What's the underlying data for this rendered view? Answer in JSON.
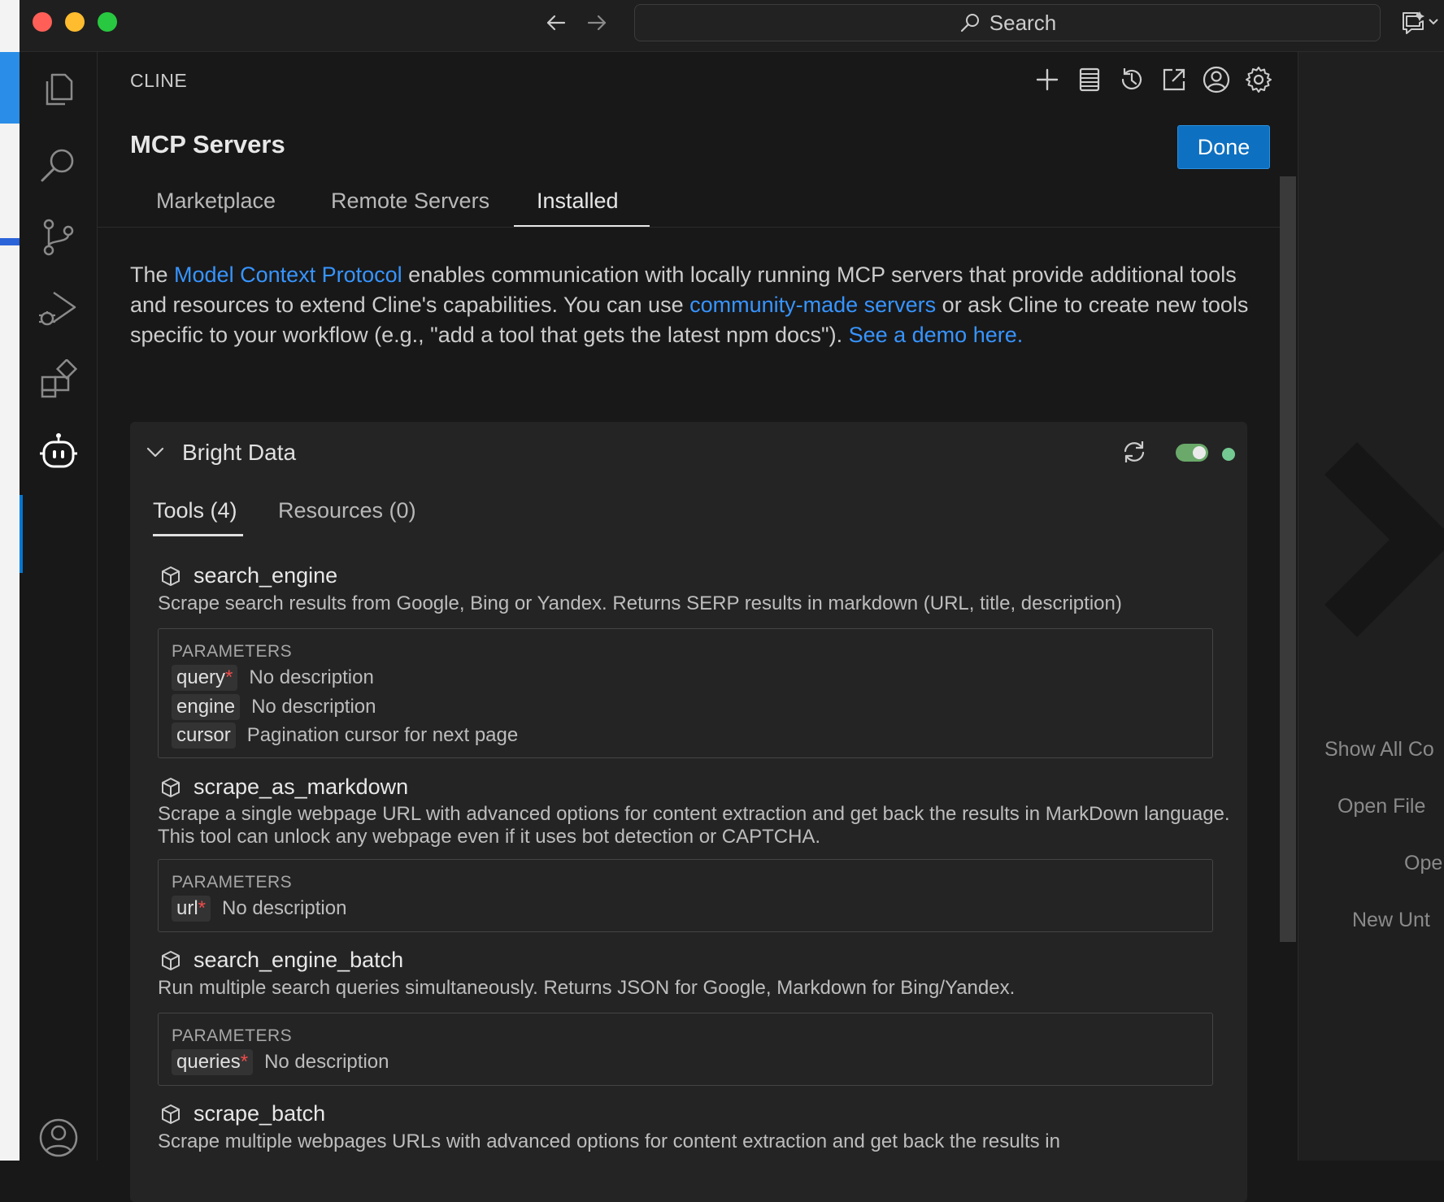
{
  "titlebar": {
    "search_label": "Search"
  },
  "panel": {
    "title": "CLINE",
    "heading": "MCP Servers",
    "done_label": "Done",
    "tabs": [
      {
        "label": "Marketplace"
      },
      {
        "label": "Remote Servers"
      },
      {
        "label": "Installed"
      }
    ],
    "intro": {
      "p1": "The ",
      "link1": "Model Context Protocol",
      "p2": " enables communication with locally running MCP servers that provide additional tools and resources to extend Cline's capabilities. You can use ",
      "link2": "community-made servers",
      "p3": " or ask Cline to create new tools specific to your workflow (e.g., \"add a tool that gets the latest npm docs\"). ",
      "link3": "See a demo here."
    }
  },
  "server": {
    "name": "Bright Data",
    "enabled": true,
    "status_color": "#73c991",
    "subtabs": [
      {
        "label": "Tools (4)"
      },
      {
        "label": "Resources (0)"
      }
    ],
    "params_label": "PARAMETERS",
    "required_mark": "*",
    "tools": [
      {
        "name": "search_engine",
        "description": "Scrape search results from Google, Bing or Yandex. Returns SERP results in markdown (URL, title, description)",
        "params": [
          {
            "name": "query",
            "description": "No description"
          },
          {
            "name": "engine",
            "description": "No description"
          },
          {
            "name": "cursor",
            "description": "Pagination cursor for next page"
          }
        ]
      },
      {
        "name": "scrape_as_markdown",
        "description": "Scrape a single webpage URL with advanced options for content extraction and get back the results in MarkDown language. This tool can unlock any webpage even if it uses bot detection or CAPTCHA.",
        "params": [
          {
            "name": "url",
            "description": "No description"
          }
        ]
      },
      {
        "name": "search_engine_batch",
        "description": "Run multiple search queries simultaneously. Returns JSON for Google, Markdown for Bing/Yandex.",
        "params": [
          {
            "name": "queries",
            "description": "No description"
          }
        ]
      },
      {
        "name": "scrape_batch",
        "description": "Scrape multiple webpages URLs with advanced options for content extraction and get back the results in"
      }
    ]
  },
  "editor": {
    "commands": [
      "Show All Co",
      "Open File",
      "Ope",
      "New Unt"
    ]
  },
  "colors": {
    "accent": "#0e70c0",
    "link": "#3794ff",
    "required": "#f14c4c"
  }
}
